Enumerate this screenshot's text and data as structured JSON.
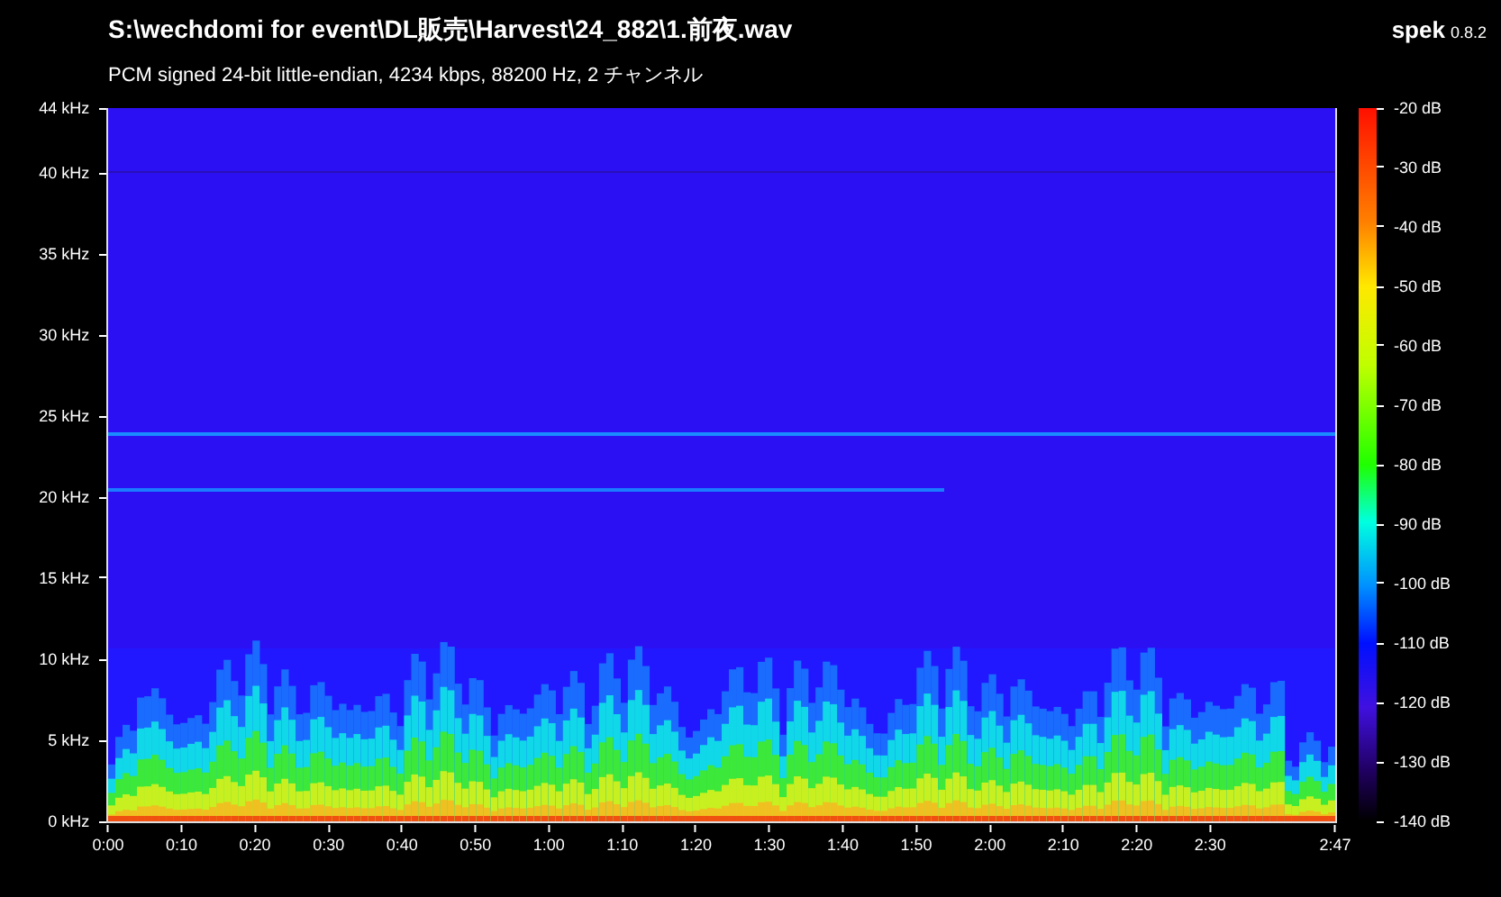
{
  "title": {
    "path": "S:\\wechdomi for event\\DL販売\\Harvest\\24_882\\1.前夜.wav",
    "app_name": "spek",
    "version": "0.8.2"
  },
  "info": "PCM signed 24-bit little-endian, 4234 kbps, 88200 Hz, 2 チャンネル",
  "frequency_axis": {
    "labels": [
      "44 kHz",
      "40 kHz",
      "35 kHz",
      "30 kHz",
      "25 kHz",
      "20 kHz",
      "15 kHz",
      "10 kHz",
      "5 kHz",
      "0 kHz"
    ]
  },
  "time_axis": {
    "labels": [
      "0:00",
      "0:10",
      "0:20",
      "0:30",
      "0:40",
      "0:50",
      "1:00",
      "1:10",
      "1:20",
      "1:30",
      "1:40",
      "1:50",
      "2:00",
      "2:10",
      "2:20",
      "2:30",
      "2:47"
    ]
  },
  "color_scale": {
    "labels": [
      "-20 dB",
      "-30 dB",
      "-40 dB",
      "-50 dB",
      "-60 dB",
      "-70 dB",
      "-80 dB",
      "-90 dB",
      "-100 dB",
      "-110 dB",
      "-120 dB",
      "-130 dB",
      "-140 dB"
    ]
  }
}
